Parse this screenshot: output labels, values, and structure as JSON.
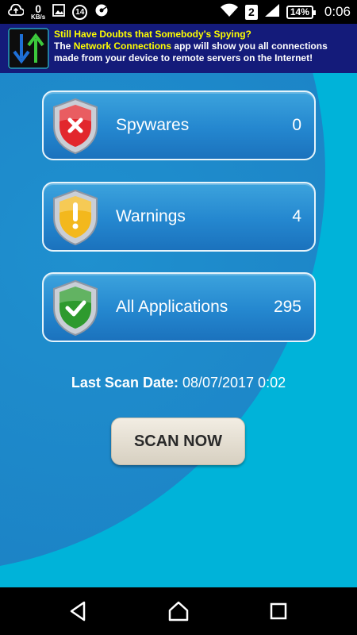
{
  "status_bar": {
    "network_speed_value": "0",
    "network_speed_unit": "KB/s",
    "notification_count": "14",
    "sim_slot": "2",
    "battery_level": "14%",
    "time": "0:06"
  },
  "ad": {
    "title": "Still Have Doubts that Somebody's Spying?",
    "body_prefix": "The",
    "app_name": "Network Connections",
    "body_suffix": "app will show you all connections made from your device to remote servers on the Internet!"
  },
  "stats": [
    {
      "label": "Spywares",
      "count": "0",
      "shield_color": "#e2272d",
      "symbol": "cross"
    },
    {
      "label": "Warnings",
      "count": "4",
      "shield_color": "#f3b81d",
      "symbol": "exclamation"
    },
    {
      "label": "All Applications",
      "count": "295",
      "shield_color": "#2e9a2e",
      "symbol": "check"
    }
  ],
  "last_scan": {
    "label": "Last Scan Date:",
    "value": "08/07/2017 0:02"
  },
  "scan_button": {
    "label": "SCAN NOW"
  },
  "colors": {
    "background": "#00b3d9",
    "card_blue": "#2487cf",
    "ad_background": "#141b7a",
    "ad_highlight": "#ffff00"
  }
}
